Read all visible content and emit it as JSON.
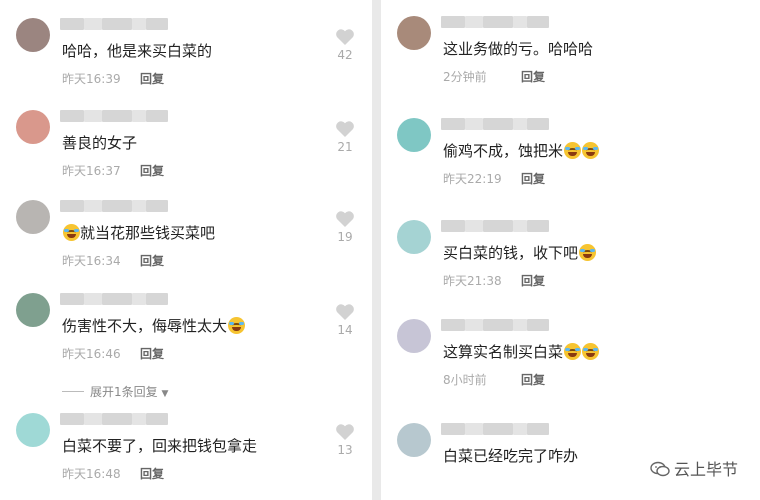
{
  "left_comments": [
    {
      "text": "哈哈，他是来买白菜的",
      "time": "昨天16:39",
      "reply": "回复",
      "likes": "42",
      "emoji": 0,
      "avatar": "#9b8580"
    },
    {
      "text": "善良的女子",
      "time": "昨天16:37",
      "reply": "回复",
      "likes": "21",
      "emoji": 0,
      "avatar": "#d9988c"
    },
    {
      "text": "就当花那些钱买菜吧",
      "time": "昨天16:34",
      "reply": "回复",
      "likes": "19",
      "emoji": 1,
      "avatar": "#b8b5b2"
    },
    {
      "text": "伤害性不大，侮辱性太大",
      "time": "昨天16:46",
      "reply": "回复",
      "likes": "14",
      "emoji": 1,
      "avatar": "#7fa08f"
    },
    {
      "text": "白菜不要了，回来把钱包拿走",
      "time": "昨天16:48",
      "reply": "回复",
      "likes": "13",
      "emoji": 0,
      "avatar": "#9fd9d6"
    }
  ],
  "expand_replies": "展开1条回复",
  "right_comments": [
    {
      "text": "这业务做的亏。哈哈哈",
      "time": "2分钟前",
      "reply": "回复",
      "emoji": 0,
      "avatar": "#a88a7a"
    },
    {
      "text": "偷鸡不成，蚀把米",
      "time": "昨天22:19",
      "reply": "回复",
      "emoji": 2,
      "avatar": "#7fc7c4"
    },
    {
      "text": "买白菜的钱，收下吧",
      "time": "昨天21:38",
      "reply": "回复",
      "emoji": 1,
      "avatar": "#a5d3d3"
    },
    {
      "text": "这算实名制买白菜",
      "time": "8小时前",
      "reply": "回复",
      "emoji": 2,
      "avatar": "#c7c5d6"
    },
    {
      "text": "白菜已经吃完了咋办",
      "time": "",
      "reply": "",
      "emoji": 0,
      "avatar": "#b7c8cf"
    }
  ],
  "watermark": "云上毕节",
  "icons": {
    "like": "heart-icon",
    "expand": "triangle-down-icon",
    "emoji_laugh": "laughing-tears-emoji",
    "emoji_smile": "smiling-emoji",
    "watermark": "wechat-logo-icon"
  },
  "colors": {
    "text": "#222222",
    "meta": "#aaaaaa",
    "reply": "#666666",
    "emoji": "#f6c431"
  }
}
